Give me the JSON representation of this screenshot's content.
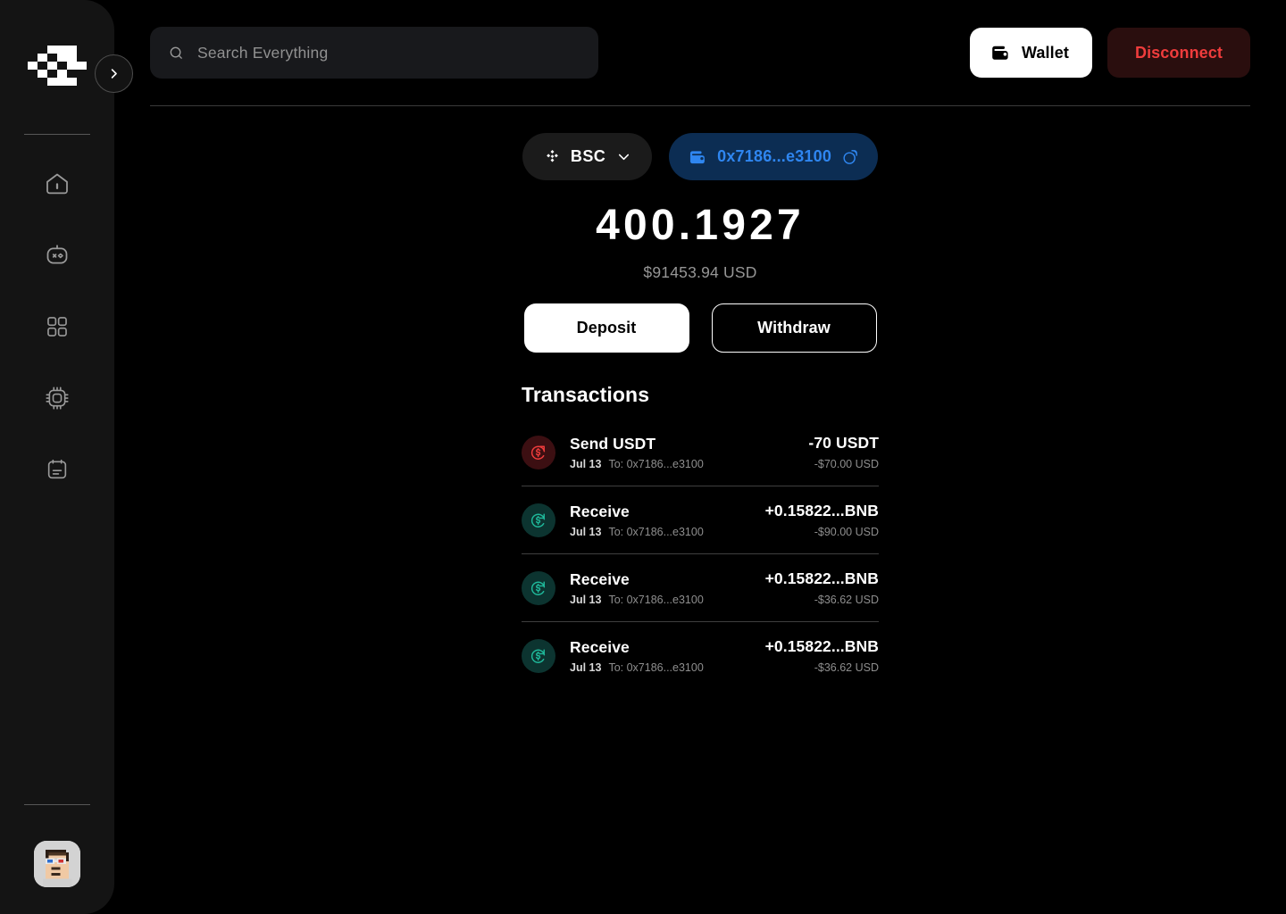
{
  "sidebar": {
    "logo_name": "checkered-logo",
    "collapse_toggle_label": "›",
    "items": [
      {
        "name": "home",
        "label": "Home"
      },
      {
        "name": "bot",
        "label": "Agents"
      },
      {
        "name": "apps",
        "label": "Apps"
      },
      {
        "name": "chip",
        "label": "Compute"
      },
      {
        "name": "notes",
        "label": "Notes"
      }
    ],
    "avatar_name": "user-avatar"
  },
  "header": {
    "search": {
      "placeholder": "Search Everything",
      "value": "",
      "icon": "search-icon"
    },
    "wallet_button": {
      "label": "Wallet",
      "icon": "wallet-icon"
    },
    "disconnect_button": {
      "label": "Disconnect"
    }
  },
  "wallet": {
    "chain": {
      "label": "BSC",
      "icon": "binance-icon",
      "chevron": "chevron-down-icon"
    },
    "address": {
      "text": "0x7186...e3100",
      "icon": "wallet-icon",
      "copy_icon": "copy-icon",
      "accent": "#2f86f0"
    },
    "balance": "400.1927",
    "balance_usd": "$91453.94 USD",
    "deposit_label": "Deposit",
    "withdraw_label": "Withdraw"
  },
  "transactions": {
    "title": "Transactions",
    "rows": [
      {
        "type": "send",
        "name": "Send USDT",
        "date": "Jul 13",
        "to": "To: 0x7186...e3100",
        "amount": "-70 USDT",
        "usd": "-$70.00 USD",
        "icon": "send-money-icon",
        "color": "#ef3c3c"
      },
      {
        "type": "receive",
        "name": "Receive",
        "date": "Jul 13",
        "to": "To: 0x7186...e3100",
        "amount": "+0.15822...BNB",
        "usd": "-$90.00 USD",
        "icon": "receive-money-icon",
        "color": "#1fb89a"
      },
      {
        "type": "receive",
        "name": "Receive",
        "date": "Jul 13",
        "to": "To: 0x7186...e3100",
        "amount": "+0.15822...BNB",
        "usd": "-$36.62 USD",
        "icon": "receive-money-icon",
        "color": "#1fb89a"
      },
      {
        "type": "receive",
        "name": "Receive",
        "date": "Jul 13",
        "to": "To: 0x7186...e3100",
        "amount": "+0.15822...BNB",
        "usd": "-$36.62 USD",
        "icon": "receive-money-icon",
        "color": "#1fb89a"
      }
    ]
  }
}
